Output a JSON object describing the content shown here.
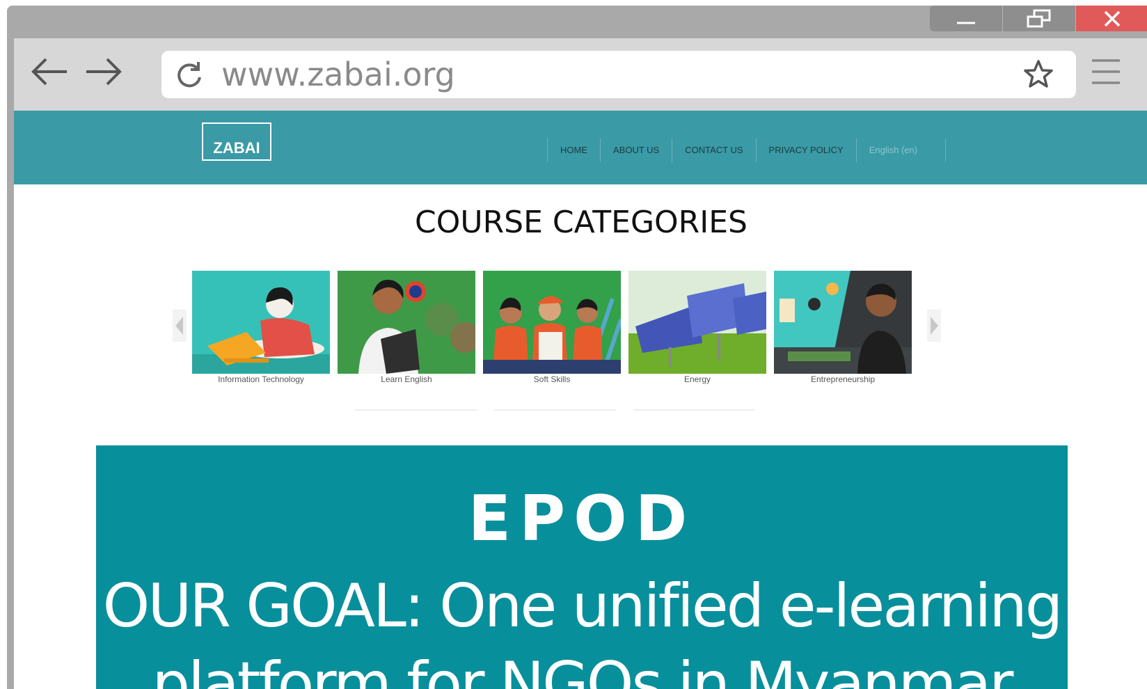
{
  "browser": {
    "url": "www.zabai.org",
    "window_controls": [
      "minimize-icon",
      "restore-icon",
      "close-icon"
    ]
  },
  "site": {
    "logo_text": "ZABAI",
    "nav": [
      {
        "label": "HOME"
      },
      {
        "label": "ABOUT US"
      },
      {
        "label": "CONTACT US"
      },
      {
        "label": "PRIVACY POLICY"
      },
      {
        "label": "English (en)"
      }
    ],
    "section_title": "COURSE CATEGORIES",
    "categories": [
      {
        "label": "Information Technology"
      },
      {
        "label": "Learn English"
      },
      {
        "label": "Soft Skills"
      },
      {
        "label": "Energy"
      },
      {
        "label": "Entrepreneurship"
      }
    ]
  },
  "banner": {
    "heading": "EPOD",
    "goal_line1": "OUR GOAL:  One unified e-learning",
    "goal_line2": "platform for NGOs in Myanmar"
  },
  "colors": {
    "header_teal": "#3a9aa6",
    "banner_teal": "#088f9c"
  }
}
